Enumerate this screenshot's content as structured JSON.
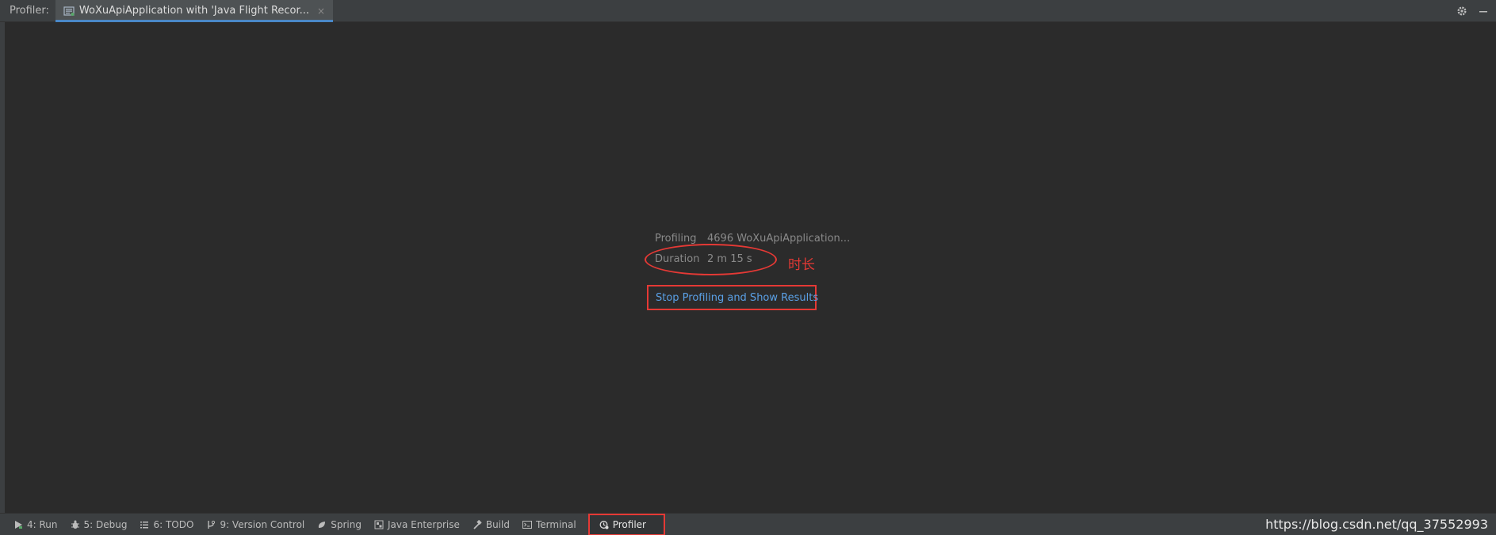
{
  "header": {
    "profiler_label": "Profiler:",
    "tab_title": "WoXuApiApplication with 'Java Flight Recor...",
    "tab_close": "×"
  },
  "session": {
    "profiling_label": "Profiling",
    "profiling_value": "4696 WoXuApiApplication...",
    "duration_label": "Duration",
    "duration_value": "2 m 15 s",
    "annotation": "时长",
    "stop_button": "Stop Profiling and Show Results"
  },
  "toolbar": {
    "items": [
      {
        "label": "4: Run",
        "icon": "run-icon"
      },
      {
        "label": "5: Debug",
        "icon": "debug-icon"
      },
      {
        "label": "6: TODO",
        "icon": "todo-icon"
      },
      {
        "label": "9: Version Control",
        "icon": "version-control-icon"
      },
      {
        "label": "Spring",
        "icon": "spring-icon"
      },
      {
        "label": "Java Enterprise",
        "icon": "java-enterprise-icon"
      },
      {
        "label": "Build",
        "icon": "build-icon"
      },
      {
        "label": "Terminal",
        "icon": "terminal-icon"
      },
      {
        "label": "Profiler",
        "icon": "profiler-icon",
        "active": true
      }
    ]
  },
  "watermark": "https://blog.csdn.net/qq_37552993",
  "colors": {
    "accent": "#4a88c7",
    "annotation": "#e53935",
    "link": "#5aa0e6",
    "background": "#2b2b2b"
  }
}
